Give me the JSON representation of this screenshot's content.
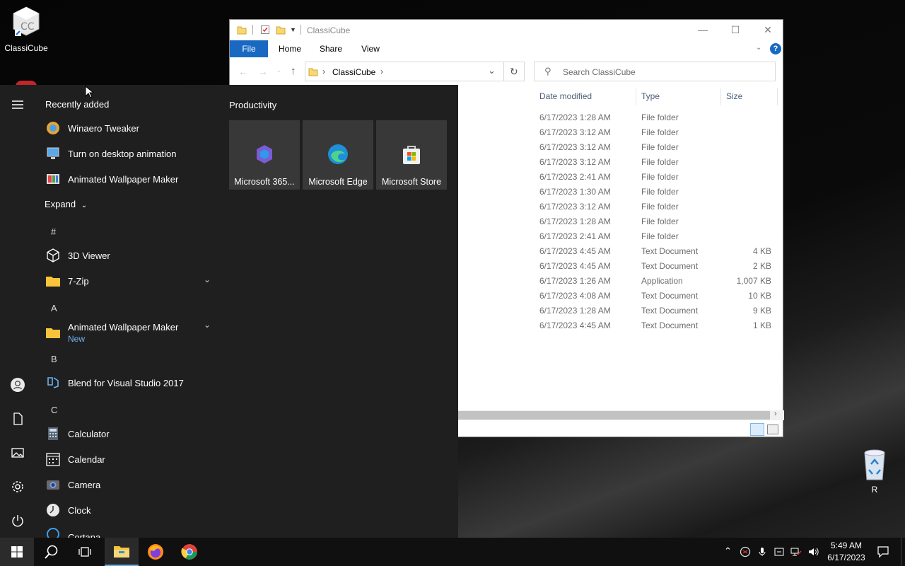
{
  "desktop": {
    "icon_top_label": "ClassiCube",
    "recycle_label": "R"
  },
  "explorer": {
    "title": "ClassiCube",
    "ribbon_tabs": [
      "File",
      "Home",
      "Share",
      "View"
    ],
    "address_crumb": "ClassiCube",
    "search_placeholder": "Search ClassiCube",
    "columns": [
      "Date modified",
      "Type",
      "Size"
    ],
    "rows": [
      {
        "date": "6/17/2023 1:28 AM",
        "type": "File folder",
        "size": ""
      },
      {
        "date": "6/17/2023 3:12 AM",
        "type": "File folder",
        "size": ""
      },
      {
        "date": "6/17/2023 3:12 AM",
        "type": "File folder",
        "size": ""
      },
      {
        "date": "6/17/2023 3:12 AM",
        "type": "File folder",
        "size": ""
      },
      {
        "date": "6/17/2023 2:41 AM",
        "type": "File folder",
        "size": ""
      },
      {
        "date": "6/17/2023 1:30 AM",
        "type": "File folder",
        "size": ""
      },
      {
        "date": "6/17/2023 3:12 AM",
        "type": "File folder",
        "size": ""
      },
      {
        "date": "6/17/2023 1:28 AM",
        "type": "File folder",
        "size": ""
      },
      {
        "date": "6/17/2023 2:41 AM",
        "type": "File folder",
        "size": ""
      },
      {
        "date": "6/17/2023 4:45 AM",
        "type": "Text Document",
        "size": "4 KB"
      },
      {
        "date": "6/17/2023 4:45 AM",
        "type": "Text Document",
        "size": "2 KB"
      },
      {
        "date": "6/17/2023 1:26 AM",
        "type": "Application",
        "size": "1,007 KB"
      },
      {
        "date": "6/17/2023 4:08 AM",
        "type": "Text Document",
        "size": "10 KB"
      },
      {
        "date": "6/17/2023 1:28 AM",
        "type": "Text Document",
        "size": "9 KB"
      },
      {
        "date": "6/17/2023 4:45 AM",
        "type": "Text Document",
        "size": "1 KB"
      }
    ]
  },
  "start": {
    "recently_added_heading": "Recently added",
    "recent": [
      "Winaero Tweaker",
      "Turn on desktop animation",
      "Animated Wallpaper Maker"
    ],
    "expand_label": "Expand",
    "letters": [
      "#",
      "A",
      "B",
      "C"
    ],
    "apps": {
      "viewer3d": "3D Viewer",
      "zip": "7-Zip",
      "awm": "Animated Wallpaper Maker",
      "awm_badge": "New",
      "blend": "Blend for Visual Studio 2017",
      "calculator": "Calculator",
      "calendar": "Calendar",
      "camera": "Camera",
      "clock": "Clock",
      "cortana": "Cortana"
    },
    "tiles_heading": "Productivity",
    "tiles": [
      "Microsoft 365...",
      "Microsoft Edge",
      "Microsoft Store"
    ]
  },
  "taskbar": {
    "time": "5:49 AM",
    "date": "6/17/2023"
  },
  "colors": {
    "accent": "#1969c2",
    "start_bg": "#1f1f1f",
    "tile_bg": "#383838"
  }
}
